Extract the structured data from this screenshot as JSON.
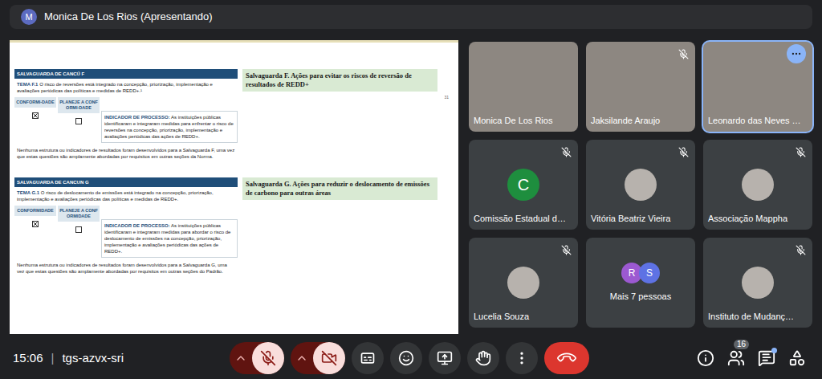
{
  "header": {
    "avatar": "M",
    "presenter": "Monica De Los Rios (Apresentando)"
  },
  "slide": {
    "page_number": "31",
    "sections": [
      {
        "header": "SALVAGUARDA DE CANCÚ F",
        "tema_label": "TEMA F.1",
        "tema_text": "O risco de reversões está integrado na concepção, priorização, implementação e avaliações periódicas das políticas e medidas de REDD+.¹",
        "columns": [
          {
            "label": "CONFORMI-DADE",
            "checked": true
          },
          {
            "label": "PLANEJE A CONFORMI-DADE",
            "checked": false
          }
        ],
        "indicator_label": "INDICADOR DE PROCESSO:",
        "indicator_text": "As instituições públicas identificaram e integraram medidas para enfrentar o risco de reversões na concepção, priorização, implementação e avaliações periódicas das ações de REDD+.",
        "note": "Nenhuma estrutura ou indicadores de resultados foram desenvolvidos para a Salvaguarda F, uma vez que estas questões são amplamente abordadas por requisitos em outras seções da Norma.",
        "title": "Salvaguarda F. Ações para evitar os riscos de reversão de resultados de REDD+"
      },
      {
        "header": "SALVAGUARDA DE CANCUN G",
        "tema_label": "TEMA G.1",
        "tema_text": "O risco de deslocamento de emissões está integrado na concepção, priorização, implementação e avaliações periódicas das políticas e medidas de REDD+.",
        "columns": [
          {
            "label": "CONFORMIDADE",
            "checked": true
          },
          {
            "label": "PLANEJE A CONFORMIDADE",
            "checked": false
          }
        ],
        "indicator_label": "INDICADOR DE PROCESSO:",
        "indicator_text": "As instituições públicas identificaram e integraram medidas para abordar o risco de deslocamento de emissões na concepção, priorização, implementação e avaliações periódicas das ações de REDD+.",
        "note": "Nenhuma estrutura ou indicadores de resultados foram desenvolvidos para a Salvaguarda G, uma vez que estas questões são amplamente abordadas por requisitos em outras seções do Padrão.",
        "title": "Salvaguarda G. Ações para reduzir o deslocamento de emissões de carbono para outras áreas"
      }
    ]
  },
  "participants": [
    {
      "name": "Monica De Los Rios",
      "kind": "video",
      "muted": false,
      "hovered": false
    },
    {
      "name": "Jaksilande Araujo",
      "kind": "video",
      "muted": true,
      "hovered": false
    },
    {
      "name": "Leonardo das Neves …",
      "kind": "video",
      "muted": false,
      "hovered": true
    },
    {
      "name": "Comissão Estadual d…",
      "kind": "letter",
      "letter": "C",
      "color": "#1e8e3e",
      "muted": true,
      "hovered": false
    },
    {
      "name": "Vitória Beatriz Vieira",
      "kind": "picture",
      "muted": true,
      "hovered": false
    },
    {
      "name": "Associação Mappha",
      "kind": "picture",
      "muted": true,
      "hovered": false
    },
    {
      "name": "Lucelia Souza",
      "kind": "picture",
      "muted": true,
      "hovered": false
    },
    {
      "name": "Mais 7 pessoas",
      "kind": "more",
      "muted": false,
      "hovered": false,
      "avatars": [
        {
          "letter": "R",
          "color": "#9c59d1"
        },
        {
          "letter": "S",
          "color": "#5e72e4"
        }
      ]
    },
    {
      "name": "Instituto de Mudanç…",
      "kind": "picture",
      "muted": true,
      "hovered": false
    }
  ],
  "footer": {
    "time": "15:06",
    "separator": "|",
    "meeting_code": "tgs-azvx-sri",
    "mic": {
      "on": false
    },
    "camera": {
      "on": false
    },
    "captions": {
      "on": false
    },
    "raise_hand": {
      "raised": false
    },
    "people_count": "16",
    "chat_unread": true
  }
}
